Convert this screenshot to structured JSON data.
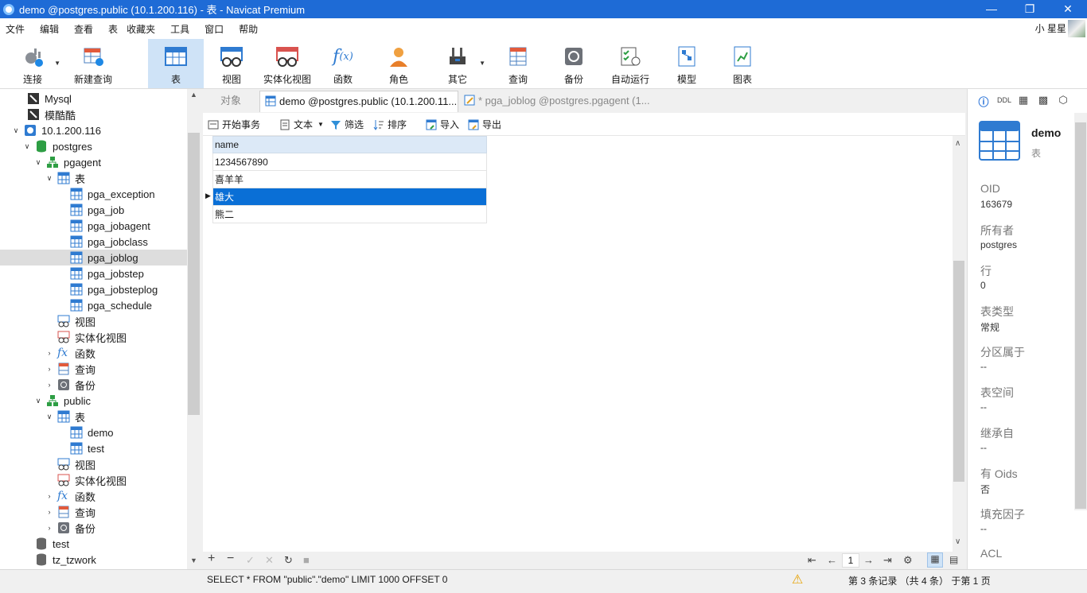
{
  "window": {
    "title": "demo @postgres.public (10.1.200.116) - 表 - Navicat Premium"
  },
  "menu": {
    "items": [
      "文件",
      "编辑",
      "查看",
      "表",
      "收藏夹",
      "工具",
      "窗口",
      "帮助"
    ],
    "user": "小 星星"
  },
  "toolbar": {
    "connect": "连接",
    "new_query": "新建查询",
    "table": "表",
    "view": "视图",
    "materialized_view": "实体化视图",
    "function": "函数",
    "role": "角色",
    "other": "其它",
    "query": "查询",
    "backup": "备份",
    "auto_run": "自动运行",
    "model": "模型",
    "chart": "图表"
  },
  "tree": {
    "items": [
      "Mysql",
      "模酷酷",
      "10.1.200.116",
      "postgres",
      "pgagent",
      "表",
      "pga_exception",
      "pga_job",
      "pga_jobagent",
      "pga_jobclass",
      "pga_joblog",
      "pga_jobstep",
      "pga_jobsteplog",
      "pga_schedule",
      "视图",
      "实体化视图",
      "函数",
      "查询",
      "备份",
      "public",
      "表",
      "demo",
      "test",
      "视图",
      "实体化视图",
      "函数",
      "查询",
      "备份",
      "test",
      "tz_tzwork"
    ]
  },
  "tabs": {
    "objects": "对象",
    "active": "demo @postgres.public (10.1.200.11...",
    "other": "* pga_joblog @postgres.pgagent (1..."
  },
  "gridtoolbar": {
    "begin_tx": "开始事务",
    "text": "文本",
    "filter": "筛选",
    "sort": "排序",
    "import": "导入",
    "export": "导出"
  },
  "grid": {
    "column": "name",
    "rows": [
      "1234567890",
      "喜羊羊",
      "雄大",
      "熊二"
    ]
  },
  "pager": {
    "page": "1"
  },
  "status": {
    "sql": "SELECT * FROM \"public\".\"demo\" LIMIT 1000 OFFSET 0",
    "record": "第 3 条记录 （共 4 条） 于第 1 页"
  },
  "info": {
    "name": "demo",
    "type": "表",
    "props": [
      {
        "label": "OID",
        "value": "163679"
      },
      {
        "label": "所有者",
        "value": "postgres"
      },
      {
        "label": "行",
        "value": "0"
      },
      {
        "label": "表类型",
        "value": "常规"
      },
      {
        "label": "分区属于",
        "value": "--"
      },
      {
        "label": "表空间",
        "value": "--"
      },
      {
        "label": "继承自",
        "value": "--"
      },
      {
        "label": "有 Oids",
        "value": "否"
      },
      {
        "label": "填充因子",
        "value": "--"
      },
      {
        "label": "ACL",
        "value": ""
      }
    ]
  },
  "colors": {
    "accent": "#1e6bd6",
    "selection": "#0a6fd6",
    "header": "#dce9f7"
  }
}
